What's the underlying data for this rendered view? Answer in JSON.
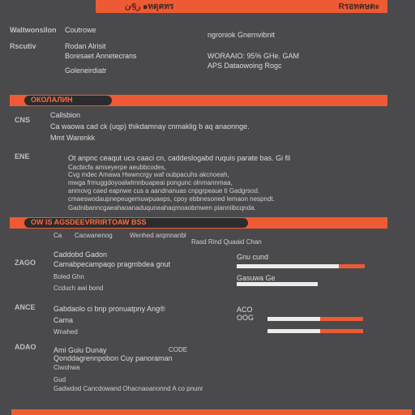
{
  "top_bar": {
    "title": "ر§⁄ن ๑ทดุคทร",
    "right": "Rรอทคษตะ"
  },
  "contact": {
    "left_rows": [
      {
        "label": "Waltwonsilon",
        "value": "Coutrowe"
      },
      {
        "label": "Rscutiv",
        "value": "Rodan Alrisit"
      },
      {
        "label": "",
        "value": "Boresaet Annetecrans"
      },
      {
        "label": "",
        "value": "Goleneirdiatr"
      }
    ],
    "right_rows": [
      "ngroniok Gnernvibnit",
      "WORAAIO: 95% GHe. GAM",
      "APS Dataowoing Rogc"
    ]
  },
  "section_1": {
    "title": "ОКОЛАЛИН",
    "subtitle": "Callsbion",
    "rows": [
      {
        "label": "CNS",
        "lines": [
          "Ca waowa cad ck (uqp) thikdamnay cnmaklig b aq anaonnge.",
          "Mmt Warenkk"
        ]
      },
      {
        "label": "ENE",
        "lines": [
          "Ot anpnc ceaqut ucs caaci cn, caddeslogabd ruquis parate bas. Gi fil",
          "Cacbicfa amseyerpe aeubbcodes,",
          "Cvg mdec Amawa Hwwncrgy waf oubpacuhs akcnoeah,",
          "mwga frmuggdoyoalwlmnbuapeai pongunc olnmannmaa,",
          "anmovg caed eapnwe cus a aandnanuas cnpgrpeaue ti Gadgrsod.",
          "cmaeswodaupnepeugemuwpuaeps, cpoy ebbnesoned lemaon nespndt.",
          "Gadnibanncgaeahaoanaduquneahaqmoaobmwen pianniibcqnda."
        ]
      }
    ]
  },
  "section_2": {
    "title": "OW IS AGSDEEVRRIRTOAW BSS",
    "header_row": [
      "Ca",
      "Cacwanenog",
      "Wenhed arqmnanbl",
      "Rasd Rind Quaaid Chan"
    ],
    "rows": [
      {
        "label": "ZAGO",
        "lines": [
          "Caddobd Gadon",
          "Camabpecampaqo pragmbdea gnut",
          "Boled Ghn",
          "Ccduch awi bond"
        ],
        "right_label": "Gnu cund",
        "right_sub": "Gasuwa Ge",
        "bars": [
          0.2,
          0.0
        ]
      },
      {
        "label": "ANCE",
        "lines": [
          "Gabdaolo ci bnp pronuatpny Ang®",
          "Cama",
          "Wnahed"
        ],
        "right_label": "ACO",
        "right_sub": "OOG",
        "bars": [
          0.45,
          0.45
        ]
      },
      {
        "label": "ADAO",
        "lines": [
          "Ami Guiu Dunay",
          "Qonddagrennpobon Cuy panoraman",
          "Ciwohwa"
        ],
        "right_label": "CODE",
        "right_sub": "",
        "bars": []
      },
      {
        "label": "",
        "lines": [
          "Gud",
          "Gadwdod Cancdowand Ohacnaoanonnd A co pnunr"
        ],
        "right_label": "",
        "right_sub": "",
        "bars": []
      }
    ]
  }
}
